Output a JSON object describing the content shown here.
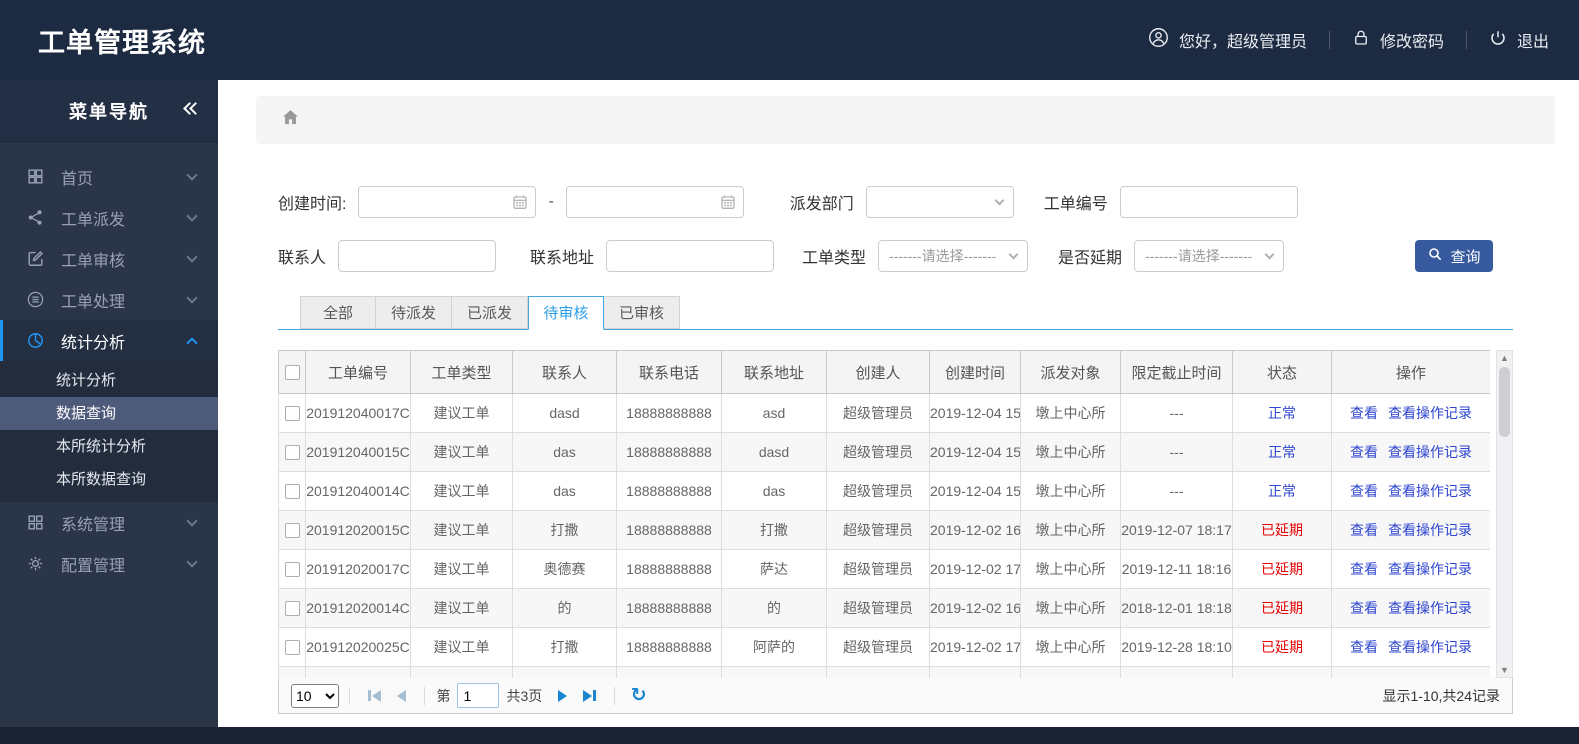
{
  "header": {
    "title": "工单管理系统",
    "greeting": "您好，超级管理员",
    "change_password": "修改密码",
    "logout": "退出"
  },
  "sidebar": {
    "title": "菜单导航",
    "items": [
      {
        "label": "首页"
      },
      {
        "label": "工单派发"
      },
      {
        "label": "工单审核"
      },
      {
        "label": "工单处理"
      },
      {
        "label": "统计分析"
      },
      {
        "label": "系统管理"
      },
      {
        "label": "配置管理"
      }
    ],
    "submenu": [
      {
        "label": "统计分析"
      },
      {
        "label": "数据查询"
      },
      {
        "label": "本所统计分析"
      },
      {
        "label": "本所数据查询"
      }
    ]
  },
  "filters": {
    "create_time_label": "创建时间:",
    "range_separator": "-",
    "dispatch_dept_label": "派发部门",
    "order_no_label": "工单编号",
    "contact_label": "联系人",
    "address_label": "联系地址",
    "order_type_label": "工单类型",
    "is_delayed_label": "是否延期",
    "select_placeholder": "-------请选择-------",
    "search_button": "查询"
  },
  "tabs": [
    {
      "label": "全部"
    },
    {
      "label": "待派发"
    },
    {
      "label": "已派发"
    },
    {
      "label": "待审核"
    },
    {
      "label": "已审核"
    }
  ],
  "table": {
    "columns": [
      "工单编号",
      "工单类型",
      "联系人",
      "联系电话",
      "联系地址",
      "创建人",
      "创建时间",
      "派发对象",
      "限定截止时间",
      "状态",
      "操作"
    ],
    "actions": {
      "view": "查看",
      "view_log": "查看操作记录"
    },
    "rows": [
      {
        "order_no": "201912040017C",
        "type": "建议工单",
        "contact": "dasd",
        "phone": "18888888888",
        "address": "asd",
        "creator": "超级管理员",
        "created": "2019-12-04 15",
        "target": "墩上中心所",
        "deadline": "---",
        "status": "正常",
        "delayed": false
      },
      {
        "order_no": "201912040015C",
        "type": "建议工单",
        "contact": "das",
        "phone": "18888888888",
        "address": "dasd",
        "creator": "超级管理员",
        "created": "2019-12-04 15",
        "target": "墩上中心所",
        "deadline": "---",
        "status": "正常",
        "delayed": false
      },
      {
        "order_no": "201912040014C",
        "type": "建议工单",
        "contact": "das",
        "phone": "18888888888",
        "address": "das",
        "creator": "超级管理员",
        "created": "2019-12-04 15",
        "target": "墩上中心所",
        "deadline": "---",
        "status": "正常",
        "delayed": false
      },
      {
        "order_no": "201912020015C",
        "type": "建议工单",
        "contact": "打撒",
        "phone": "18888888888",
        "address": "打撒",
        "creator": "超级管理员",
        "created": "2019-12-02 16",
        "target": "墩上中心所",
        "deadline": "2019-12-07 18:17",
        "status": "已延期",
        "delayed": true
      },
      {
        "order_no": "201912020017C",
        "type": "建议工单",
        "contact": "奥德赛",
        "phone": "18888888888",
        "address": "萨达",
        "creator": "超级管理员",
        "created": "2019-12-02 17",
        "target": "墩上中心所",
        "deadline": "2019-12-11 18:16",
        "status": "已延期",
        "delayed": true
      },
      {
        "order_no": "201912020014C",
        "type": "建议工单",
        "contact": "的",
        "phone": "18888888888",
        "address": "的",
        "creator": "超级管理员",
        "created": "2019-12-02 16",
        "target": "墩上中心所",
        "deadline": "2018-12-01 18:18",
        "status": "已延期",
        "delayed": true
      },
      {
        "order_no": "201912020025C",
        "type": "建议工单",
        "contact": "打撒",
        "phone": "18888888888",
        "address": "阿萨的",
        "creator": "超级管理员",
        "created": "2019-12-02 17",
        "target": "墩上中心所",
        "deadline": "2019-12-28 18:10",
        "status": "已延期",
        "delayed": true
      }
    ]
  },
  "pagination": {
    "page_size": "10",
    "page_prefix": "第",
    "current_page": "1",
    "total_pages": "共3页",
    "summary": "显示1-10,共24记录"
  },
  "colors": {
    "header_bg": "#1d2b42",
    "sidebar_bg": "#2b3548",
    "accent_blue": "#2196f3",
    "tab_blue": "#42a5e0",
    "link_blue": "#2f46d0",
    "status_delayed_red": "#e60000",
    "search_button_bg": "#375a9e"
  }
}
